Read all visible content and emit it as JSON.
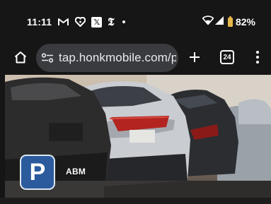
{
  "status_bar": {
    "time": "11:11",
    "notification_icons": [
      "gmail-icon",
      "heart-app-icon",
      "x-app-icon",
      "nyt-icon",
      "more-dot-icon"
    ],
    "x_icon_text": "𝕏",
    "nyt_icon_text": "𝕿",
    "battery_percent": "82%",
    "battery_level": 0.82,
    "battery_color": "#e5b64a"
  },
  "toolbar": {
    "url": "tap.honkmobile.com/p/fa",
    "tab_count": "24"
  },
  "page": {
    "logo_letter": "P",
    "logo_color": "#2b5b9c",
    "brand_name": "ABM"
  }
}
